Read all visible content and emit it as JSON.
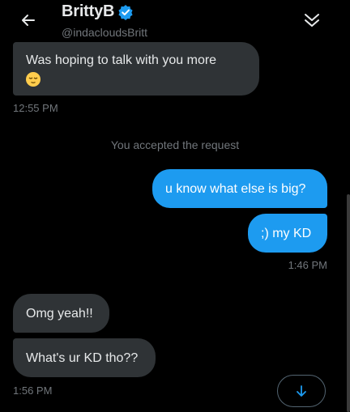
{
  "header": {
    "display_name": "BrittyB",
    "handle": "@indacloudsBritt",
    "back_icon": "arrow-left-icon",
    "verified_icon": "verified-badge-icon",
    "collapse_icon": "double-chevron-down-icon"
  },
  "messages": {
    "m1": {
      "text": "Was hoping to talk with you more",
      "emoji": "relieved-face-emoji",
      "time": "12:55 PM"
    },
    "system": "You accepted the request",
    "m2": {
      "text": "u know what else is big?"
    },
    "m3": {
      "text": ";) my KD",
      "time": "1:46 PM"
    },
    "m4": {
      "text": "Omg yeah!!"
    },
    "m5": {
      "text": "What's ur KD tho??",
      "time": "1:56 PM"
    }
  },
  "scroll_button": {
    "icon": "arrow-down-icon"
  },
  "colors": {
    "accent": "#1d9bf0",
    "bubble_received": "#2f3336",
    "background": "#000000",
    "muted": "#71767b"
  }
}
